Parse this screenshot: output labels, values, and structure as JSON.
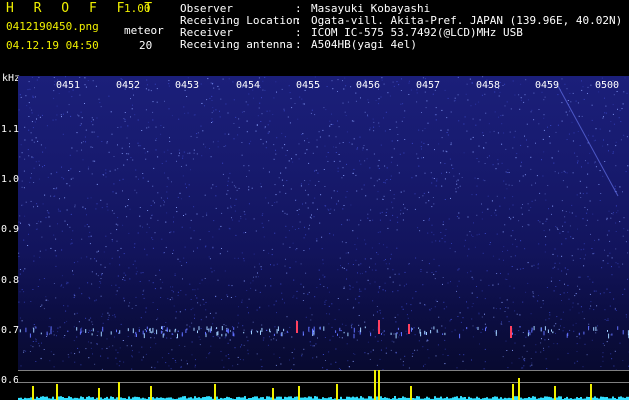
{
  "header": {
    "title": "H R O F F T",
    "version": "1.00",
    "filename": "0412190450.png",
    "meteor_label": "meteor",
    "datetime": "04.12.19 04:50",
    "meteor_count": "20",
    "info": [
      {
        "key": "Observer",
        "sep": ":",
        "value": "Masayuki Kobayashi"
      },
      {
        "key": "Receiving Location",
        "sep": ":",
        "value": "Ogata-vill. Akita-Pref. JAPAN (139.96E, 40.02N)"
      },
      {
        "key": "Receiver",
        "sep": ":",
        "value": "ICOM IC-575 53.7492(@LCD)MHz USB"
      },
      {
        "key": "Receiving antenna",
        "sep": ":",
        "value": "A504HB(yagi 4el)"
      }
    ]
  },
  "axis": {
    "unit": "kHz",
    "y_ticks": [
      "1.1",
      "1.0",
      "0.9",
      "0.8",
      "0.7",
      "0.6"
    ],
    "x_ticks": [
      "0451",
      "0452",
      "0453",
      "0454",
      "0455",
      "0456",
      "0457",
      "0458",
      "0459",
      "0500"
    ]
  },
  "colors": {
    "header_text": "#f0f000",
    "label_text": "#ffffff",
    "spectrogram_bg": "#171a6e",
    "meteor_echo": "#ff4060",
    "strip_bars": "#f0f000",
    "strip_baseline": "#30e0ff"
  }
}
